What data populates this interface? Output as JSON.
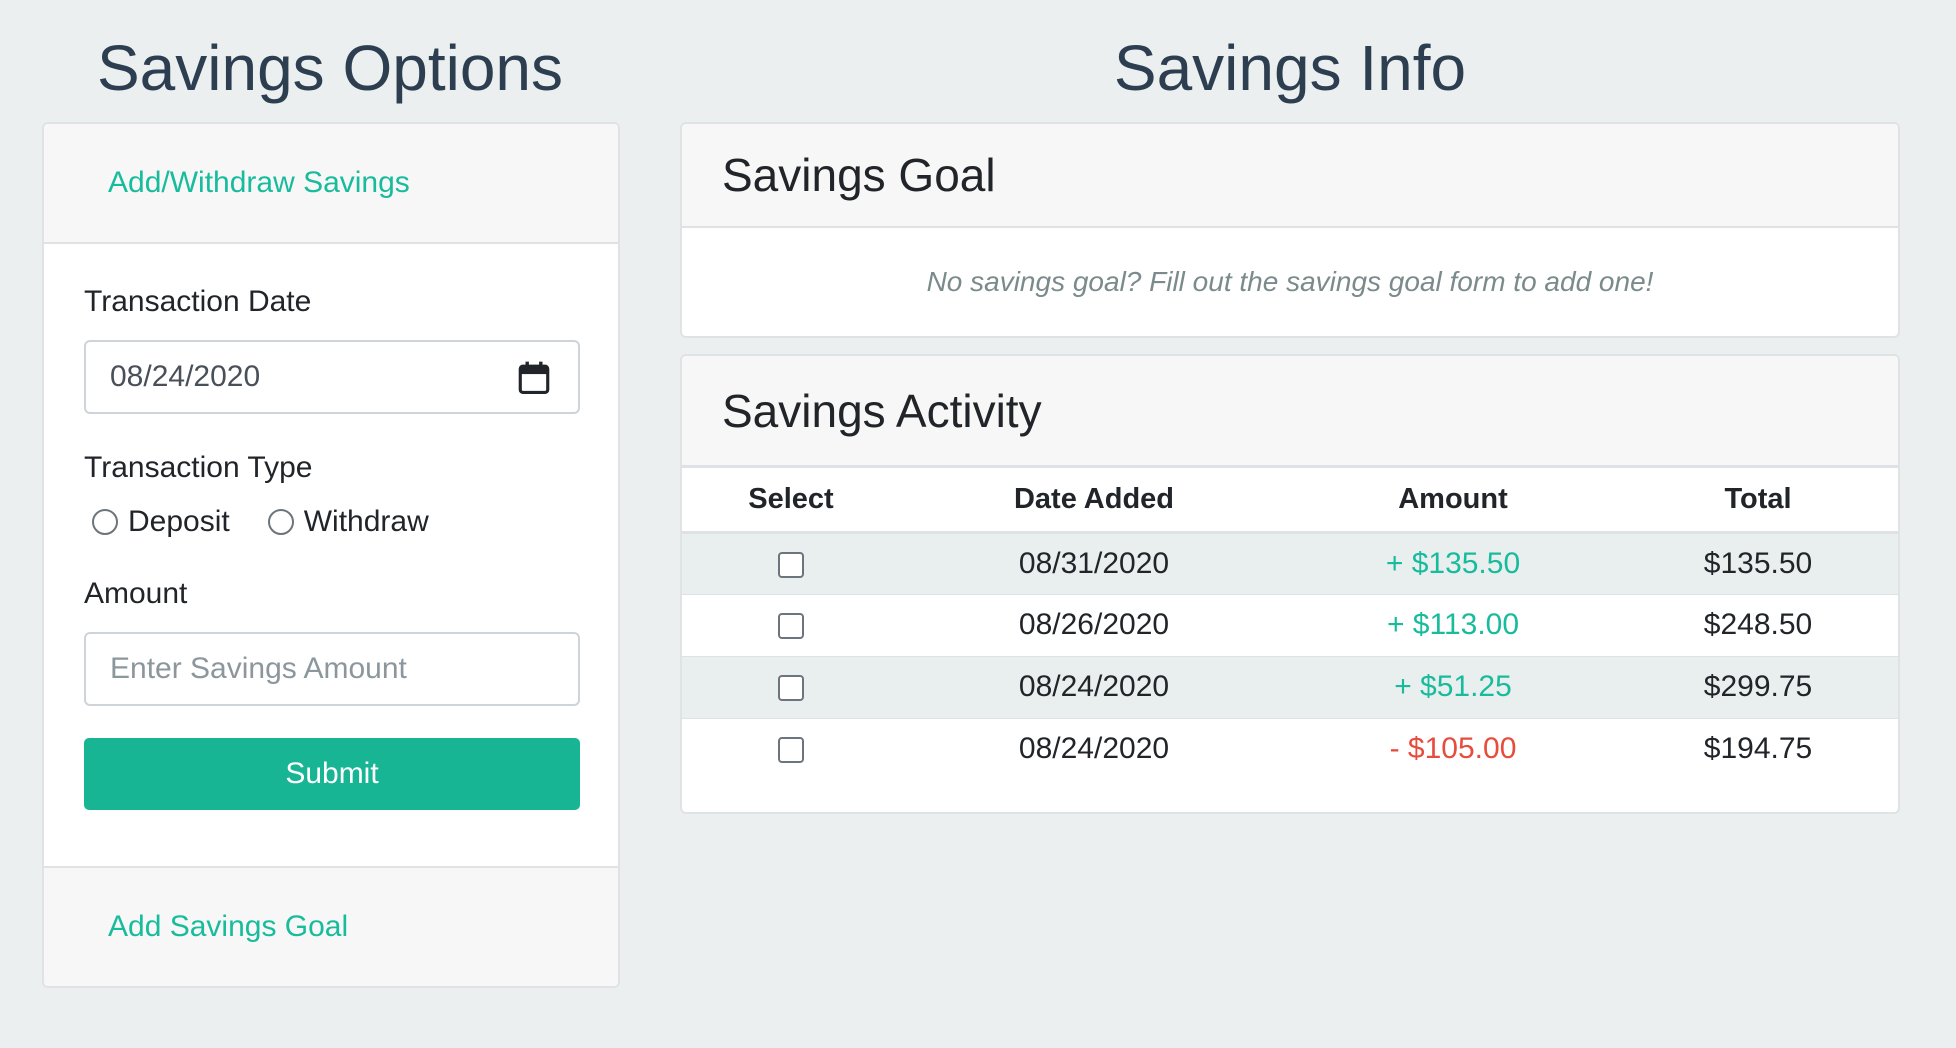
{
  "left_title": "Savings Options",
  "right_title": "Savings Info",
  "options": {
    "add_withdraw_label": "Add/Withdraw Savings",
    "date_label": "Transaction Date",
    "date_value": "08/24/2020",
    "type_label": "Transaction Type",
    "type_options": [
      "Deposit",
      "Withdraw"
    ],
    "amount_label": "Amount",
    "amount_placeholder": "Enter Savings Amount",
    "submit_label": "Submit",
    "add_goal_label": "Add Savings Goal"
  },
  "goal": {
    "header": "Savings Goal",
    "empty_message": "No savings goal? Fill out the savings goal form to add one!"
  },
  "activity": {
    "header": "Savings Activity",
    "columns": [
      "Select",
      "Date Added",
      "Amount",
      "Total"
    ],
    "rows": [
      {
        "date": "08/31/2020",
        "amount": "+ $135.50",
        "total": "$135.50"
      },
      {
        "date": "08/26/2020",
        "amount": "+ $113.00",
        "total": "$248.50"
      },
      {
        "date": "08/24/2020",
        "amount": "+ $51.25",
        "total": "$299.75"
      },
      {
        "date": "08/24/2020",
        "amount": "- $105.00",
        "total": "$194.75"
      }
    ]
  },
  "colors": {
    "accent": "#18bc9c",
    "negative": "#e74c3c",
    "heading": "#2c3e50",
    "background": "#ebeff0"
  },
  "icons": {
    "date_picker": "calendar-icon"
  }
}
